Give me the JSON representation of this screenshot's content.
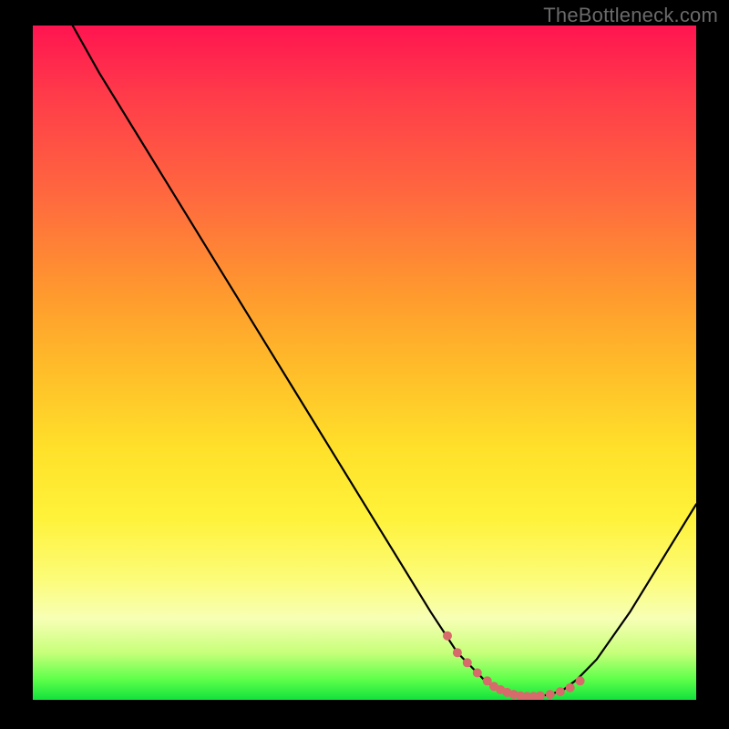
{
  "watermark": "TheBottleneck.com",
  "chart_data": {
    "type": "line",
    "title": "",
    "xlabel": "",
    "ylabel": "",
    "xlim": [
      0,
      100
    ],
    "ylim": [
      0,
      100
    ],
    "series": [
      {
        "name": "bottleneck-curve",
        "x": [
          6,
          10,
          15,
          20,
          25,
          30,
          35,
          40,
          45,
          50,
          55,
          60,
          62,
          64,
          66,
          68,
          70,
          72,
          74,
          76,
          78,
          80,
          82,
          85,
          90,
          95,
          100
        ],
        "y": [
          100,
          93,
          85,
          77,
          69,
          61,
          53,
          45,
          37,
          29,
          21,
          13,
          10,
          7,
          5,
          3,
          1.5,
          0.8,
          0.5,
          0.5,
          0.8,
          1.5,
          3,
          6,
          13,
          21,
          29
        ]
      }
    ],
    "highlight_points": {
      "name": "optimal-range",
      "x": [
        62.5,
        64,
        65.5,
        67,
        68.5,
        69.5,
        70.5,
        71.5,
        72.5,
        73.5,
        74.5,
        75.5,
        76.5,
        78,
        79.5,
        81,
        82.5
      ],
      "y": [
        9.5,
        7,
        5.5,
        4,
        2.8,
        2.0,
        1.5,
        1.1,
        0.8,
        0.6,
        0.5,
        0.5,
        0.6,
        0.8,
        1.2,
        1.8,
        2.8
      ]
    },
    "gradient_axis": "y",
    "gradient_meaning": "bottleneck severity (top=red=high, bottom=green=low)"
  }
}
